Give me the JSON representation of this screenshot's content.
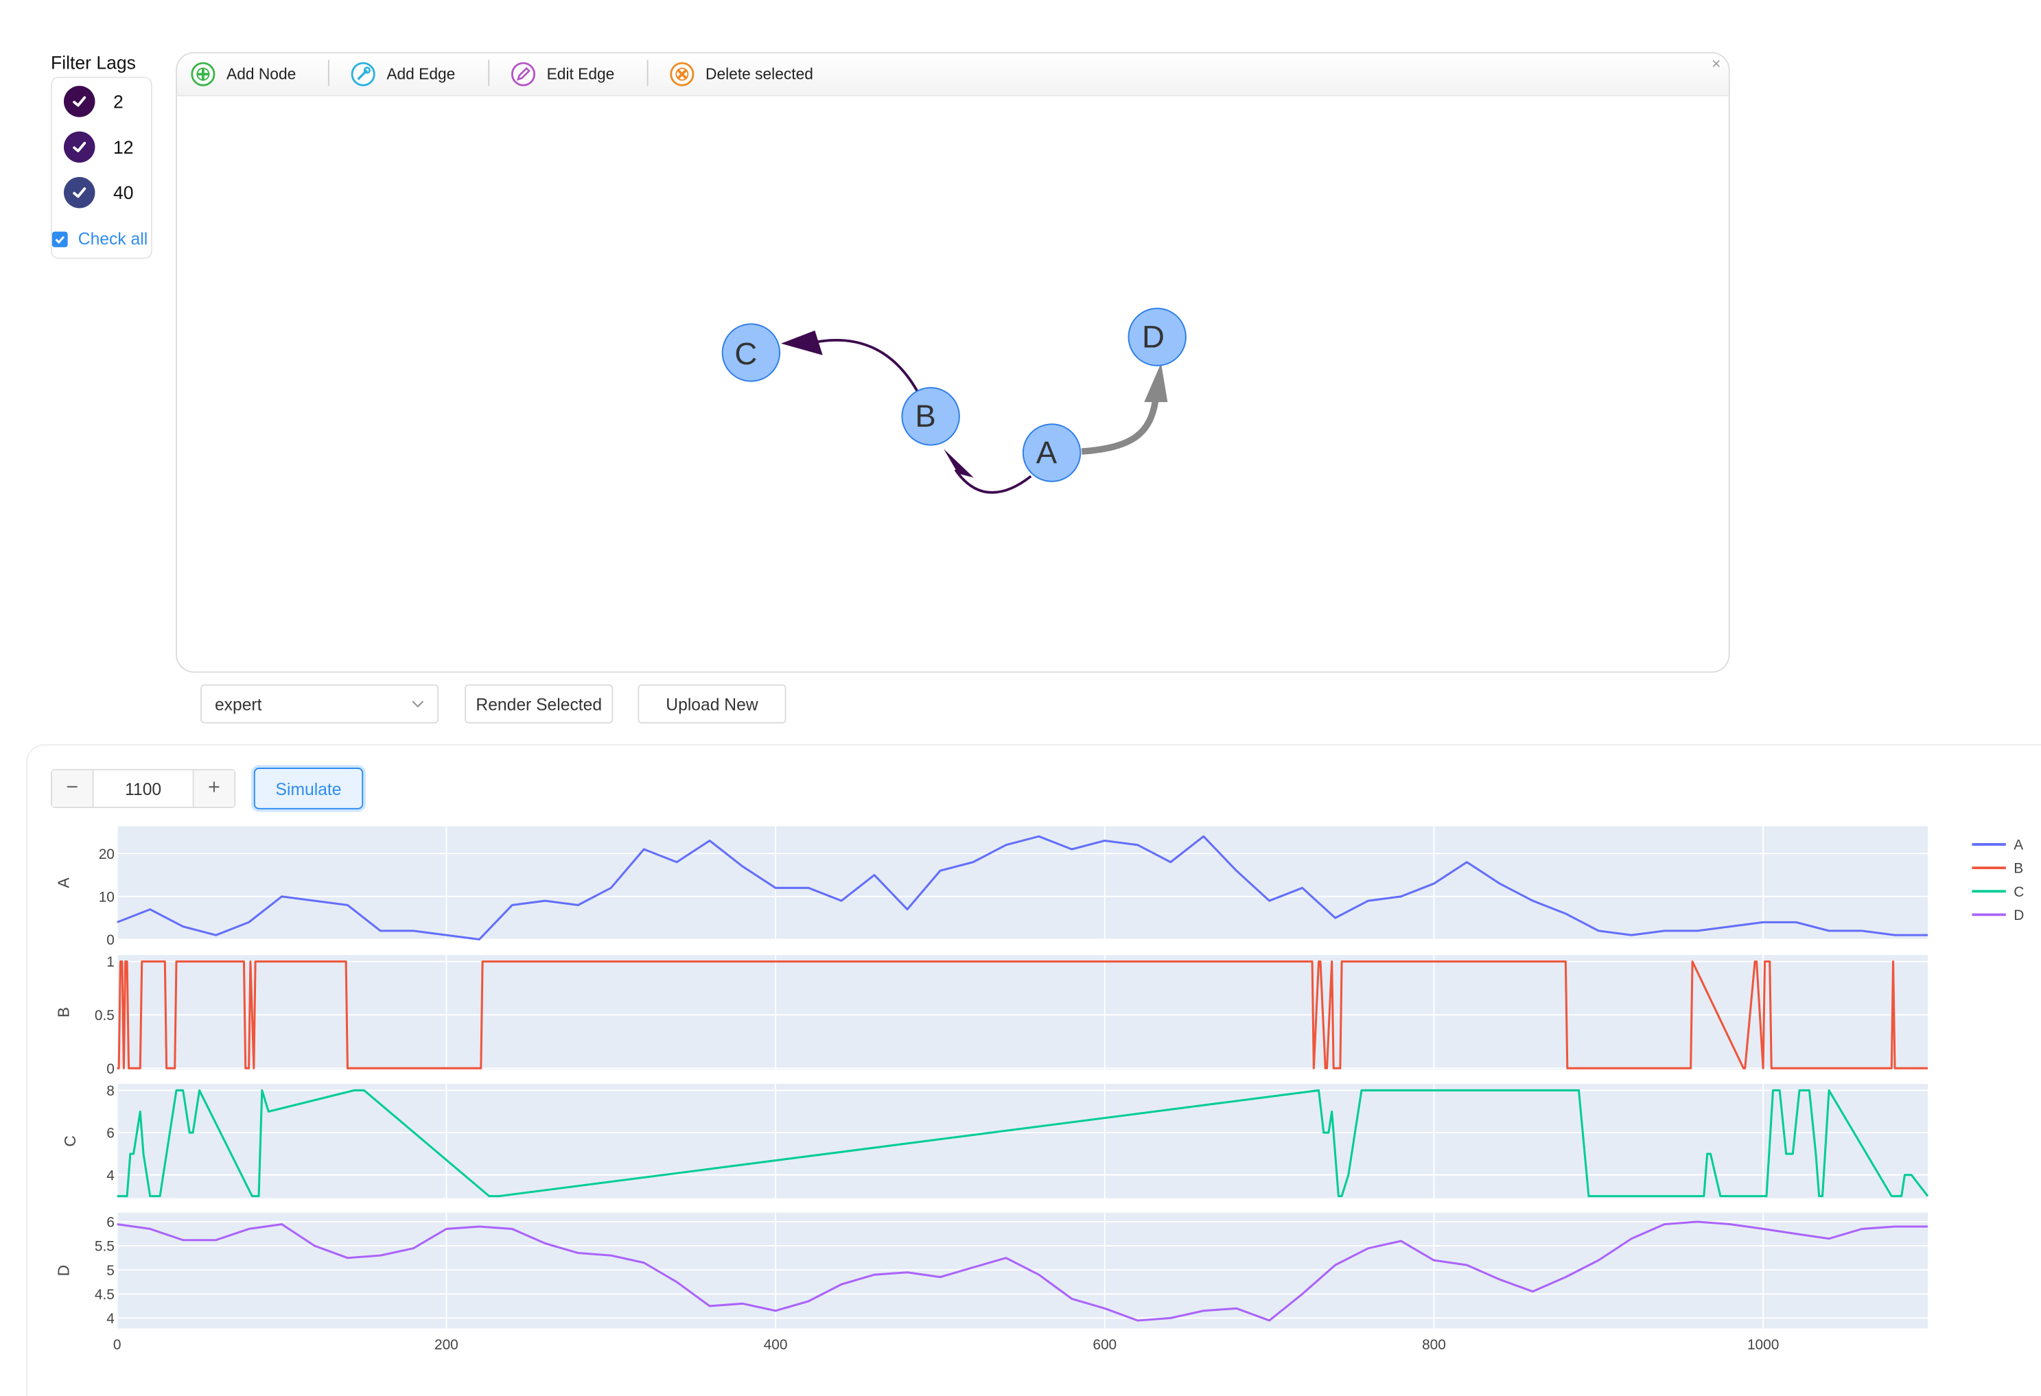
{
  "filter": {
    "title": "Filter Lags",
    "lags": [
      {
        "label": "2",
        "color": "#3d0a4f"
      },
      {
        "label": "12",
        "color": "#43176a"
      },
      {
        "label": "40",
        "color": "#3b4483"
      }
    ],
    "check_all": "Check all"
  },
  "toolbar": {
    "add_node": "Add Node",
    "add_edge": "Add Edge",
    "edit_edge": "Edit Edge",
    "delete_selected": "Delete selected",
    "close": "×"
  },
  "graph": {
    "nodes": [
      {
        "id": "A",
        "label": "A"
      },
      {
        "id": "B",
        "label": "B"
      },
      {
        "id": "C",
        "label": "C"
      },
      {
        "id": "D",
        "label": "D"
      }
    ],
    "edges": [
      {
        "from": "A",
        "to": "B",
        "color": "#3d0a4f"
      },
      {
        "from": "B",
        "to": "C",
        "color": "#3d0a4f"
      },
      {
        "from": "A",
        "to": "D",
        "color": "#888888"
      }
    ],
    "node_fill": "#97c2fc",
    "node_stroke": "#2b7ce9"
  },
  "controls": {
    "select_value": "expert",
    "render_selected": "Render Selected",
    "upload_new": "Upload New"
  },
  "simulation": {
    "steps": "1100",
    "minus": "−",
    "plus": "+",
    "simulate_label": "Simulate"
  },
  "chart_data": {
    "type": "line",
    "x_range": [
      0,
      1100
    ],
    "x_ticks": [
      "0",
      "200",
      "400",
      "600",
      "800",
      "1000"
    ],
    "legend_position": "right",
    "grid": true,
    "subplots": [
      {
        "name": "A",
        "ylabel": "A",
        "color": "#636efa",
        "ylim": [
          0,
          26
        ],
        "yticks": [
          "0",
          "10",
          "20"
        ],
        "x": [
          0,
          20,
          40,
          60,
          80,
          100,
          120,
          140,
          160,
          180,
          200,
          220,
          240,
          260,
          280,
          300,
          320,
          340,
          360,
          380,
          400,
          420,
          440,
          460,
          480,
          500,
          520,
          540,
          560,
          580,
          600,
          620,
          640,
          660,
          680,
          700,
          720,
          740,
          760,
          780,
          800,
          820,
          840,
          860,
          880,
          900,
          920,
          940,
          960,
          980,
          1000,
          1020,
          1040,
          1060,
          1080,
          1100
        ],
        "y": [
          4,
          7,
          3,
          1,
          4,
          10,
          9,
          8,
          2,
          2,
          1,
          0,
          8,
          9,
          8,
          12,
          21,
          18,
          23,
          17,
          12,
          12,
          9,
          15,
          7,
          16,
          18,
          22,
          24,
          21,
          23,
          22,
          18,
          24,
          16,
          9,
          12,
          5,
          9,
          10,
          13,
          18,
          13,
          9,
          6,
          2,
          1,
          2,
          2,
          3,
          4,
          4,
          2,
          2,
          1,
          1
        ]
      },
      {
        "name": "B",
        "ylabel": "B",
        "color": "#ef553b",
        "ylim": [
          0,
          1
        ],
        "yticks": [
          "0",
          "0.5",
          "1"
        ],
        "x": [
          0,
          1,
          2,
          3,
          4,
          5,
          6,
          7,
          14,
          15,
          29,
          30,
          35,
          36,
          77,
          78,
          80,
          81,
          83,
          84,
          139,
          140,
          221,
          222,
          726,
          727,
          730,
          731,
          734,
          735,
          738,
          739,
          743,
          744,
          880,
          881,
          956,
          957,
          988,
          989,
          995,
          996,
          1000,
          1001,
          1004,
          1005,
          1013,
          1014,
          1078,
          1079,
          1080,
          1100
        ],
        "y": [
          0,
          0,
          1,
          1,
          0,
          1,
          1,
          0,
          0,
          1,
          1,
          0,
          0,
          1,
          1,
          0,
          0,
          1,
          0,
          1,
          1,
          0,
          0,
          1,
          1,
          0,
          1,
          1,
          0,
          0,
          1,
          0,
          0,
          1,
          1,
          0,
          0,
          1,
          0,
          0,
          1,
          1,
          0,
          1,
          1,
          0,
          0,
          0,
          0,
          1,
          0,
          0
        ]
      },
      {
        "name": "C",
        "ylabel": "C",
        "color": "#00cc96",
        "ylim": [
          2.5,
          8.2
        ],
        "yticks": [
          "4",
          "6",
          "8"
        ],
        "x": [
          0,
          6,
          8,
          10,
          14,
          16,
          20,
          26,
          36,
          40,
          44,
          46,
          50,
          82,
          86,
          88,
          92,
          144,
          150,
          226,
          232,
          730,
          733,
          736,
          738,
          742,
          744,
          748,
          756,
          888,
          894,
          964,
          966,
          968,
          974,
          1002,
          1006,
          1010,
          1014,
          1018,
          1022,
          1028,
          1032,
          1034,
          1036,
          1040,
          1078,
          1080,
          1084,
          1086,
          1090,
          1100
        ],
        "y": [
          3,
          3,
          5,
          5,
          7,
          5,
          3,
          3,
          8,
          8,
          6,
          6,
          8,
          3,
          3,
          8,
          7,
          8,
          8,
          3,
          3,
          8,
          6,
          6,
          7,
          3,
          3,
          4,
          8,
          8,
          3,
          3,
          5,
          5,
          3,
          3,
          8,
          8,
          5,
          5,
          8,
          8,
          5,
          3,
          3,
          8,
          3,
          3,
          3,
          4,
          4,
          3
        ]
      },
      {
        "name": "D",
        "ylabel": "D",
        "color": "#ab63fa",
        "ylim": [
          3.85,
          6.1
        ],
        "yticks": [
          "4",
          "4.5",
          "5",
          "5.5",
          "6"
        ],
        "x": [
          0,
          20,
          40,
          60,
          80,
          100,
          120,
          140,
          160,
          180,
          200,
          220,
          240,
          260,
          280,
          300,
          320,
          340,
          360,
          380,
          400,
          420,
          440,
          460,
          480,
          500,
          520,
          540,
          560,
          580,
          600,
          620,
          640,
          660,
          680,
          700,
          720,
          740,
          760,
          780,
          800,
          820,
          840,
          860,
          880,
          900,
          920,
          940,
          960,
          980,
          1000,
          1020,
          1040,
          1060,
          1080,
          1100
        ],
        "y": [
          5.95,
          5.85,
          5.62,
          5.62,
          5.85,
          5.95,
          5.5,
          5.25,
          5.3,
          5.45,
          5.85,
          5.9,
          5.85,
          5.55,
          5.35,
          5.3,
          5.15,
          4.75,
          4.25,
          4.3,
          4.15,
          4.35,
          4.7,
          4.9,
          4.95,
          4.85,
          5.05,
          5.25,
          4.9,
          4.4,
          4.2,
          3.95,
          4.0,
          4.15,
          4.2,
          3.95,
          4.5,
          5.1,
          5.45,
          5.6,
          5.2,
          5.1,
          4.8,
          4.55,
          4.85,
          5.2,
          5.65,
          5.95,
          6.0,
          5.95,
          5.85,
          5.75,
          5.65,
          5.85,
          5.9,
          5.9
        ]
      }
    ]
  }
}
